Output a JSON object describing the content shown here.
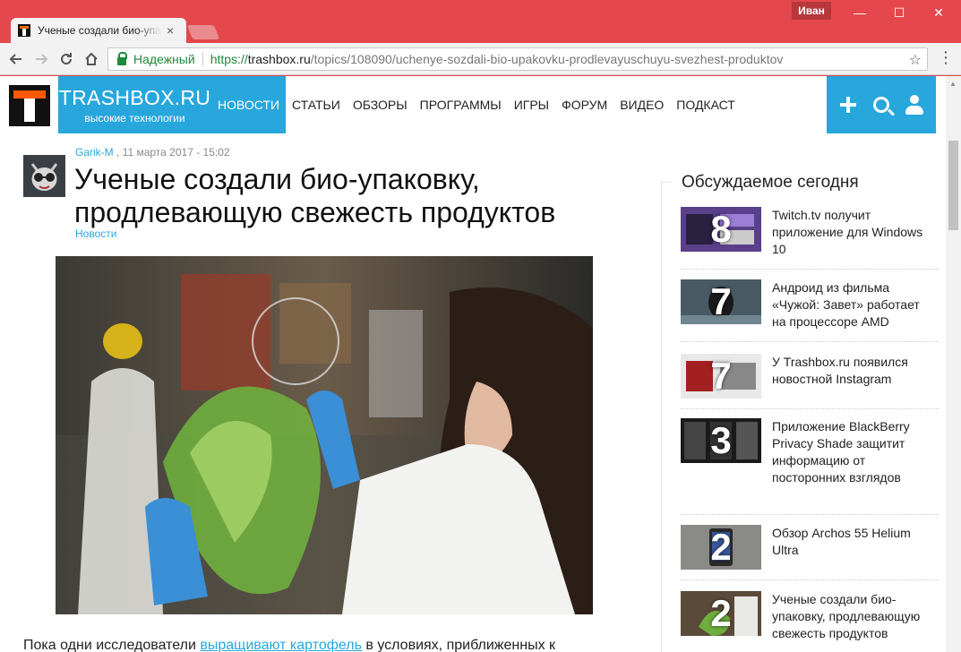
{
  "browser": {
    "tab_title": "Ученые создали био-упа",
    "tab_close": "×",
    "user_name": "Иван",
    "window_controls": {
      "minimize": "—",
      "maximize": "☐",
      "close": "✕"
    },
    "secure_label": "Надежный",
    "url_scheme": "https://",
    "url_host": "trashbox.ru",
    "url_path": "/topics/108090/uchenye-sozdali-bio-upakovku-prodlevayuschuyu-svezhest-produktov",
    "icons": {
      "back": "arrow-left-icon",
      "forward": "arrow-right-icon",
      "reload": "reload-icon",
      "home": "home-icon",
      "bookmark": "star-icon",
      "menu": "kebab-menu-icon"
    }
  },
  "site": {
    "brand_name": "TRASHBOX.RU",
    "brand_tagline": "высокие технологии",
    "accent_color": "#27a7dc",
    "logo_color": "#ff5a00",
    "nav": [
      {
        "label": "НОВОСТИ",
        "active": true
      },
      {
        "label": "СТАТЬИ",
        "active": false
      },
      {
        "label": "ОБЗОРЫ",
        "active": false
      },
      {
        "label": "ПРОГРАММЫ",
        "active": false
      },
      {
        "label": "ИГРЫ",
        "active": false
      },
      {
        "label": "ФОРУМ",
        "active": false
      },
      {
        "label": "ВИДЕО",
        "active": false
      },
      {
        "label": "ПОДКАСТ",
        "active": false
      }
    ],
    "actions": {
      "add": "plus-icon",
      "search": "search-icon",
      "profile": "user-icon"
    }
  },
  "article": {
    "author": "Garik-M",
    "date": " , 11 марта 2017 - 15:02",
    "title": "Ученые создали био-упаковку, продлевающую свежесть продуктов",
    "category": "Новости",
    "body_start": "Пока одни исследователи ",
    "body_link": "выращивают картофель",
    "body_end": " в условиях, приближенных к"
  },
  "sidebar": {
    "title": "Обсуждаемое сегодня",
    "topics": [
      {
        "rank": "8",
        "title": "Twitch.tv получит приложение для Windows 10"
      },
      {
        "rank": "7",
        "title": "Андроид из фильма «Чужой: Завет» работает на процессоре AMD"
      },
      {
        "rank": "7",
        "title": "У Trashbox.ru появился новостной Instagram"
      },
      {
        "rank": "3",
        "title": "Приложение BlackBerry Privacy Shade защитит информацию от посторонних взглядов"
      },
      {
        "rank": "2",
        "title": "Обзор Archos 55 Helium Ultra"
      },
      {
        "rank": "2",
        "title": "Ученые создали био-упаковку, продлевающую свежесть продуктов"
      }
    ]
  }
}
